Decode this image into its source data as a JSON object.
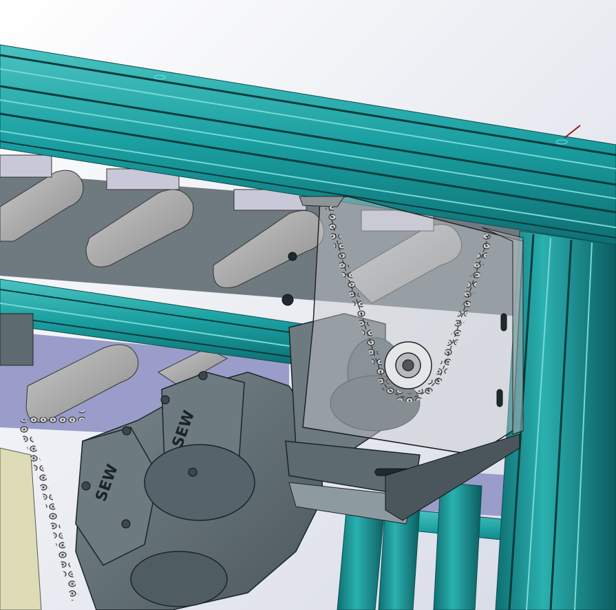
{
  "scene": {
    "description_visible_text": {
      "gear_motor_front_label": "SEW",
      "gear_motor_back_label": "SEW"
    },
    "colors": {
      "background_top": "#ffffff",
      "background_bottom": "#d6dae6",
      "aluminum_profile": "#1a9ea0",
      "aluminum_profile_light": "#49c0bf",
      "aluminum_profile_dark": "#0c5f63",
      "motor_body": "#5d6b70",
      "roller": "#a8a8a8",
      "guard_transparent": "#c9ccd0",
      "chain": "#cfcfcf",
      "panel_yellow": "#dedcb6",
      "conveyor_bed": "#6f7a80",
      "lavender": "#9a9dc9"
    },
    "components": [
      "aluminum-profile-frame",
      "chain-drive",
      "transparent-chain-guard",
      "gear-motor",
      "rollers",
      "sprocket"
    ]
  }
}
